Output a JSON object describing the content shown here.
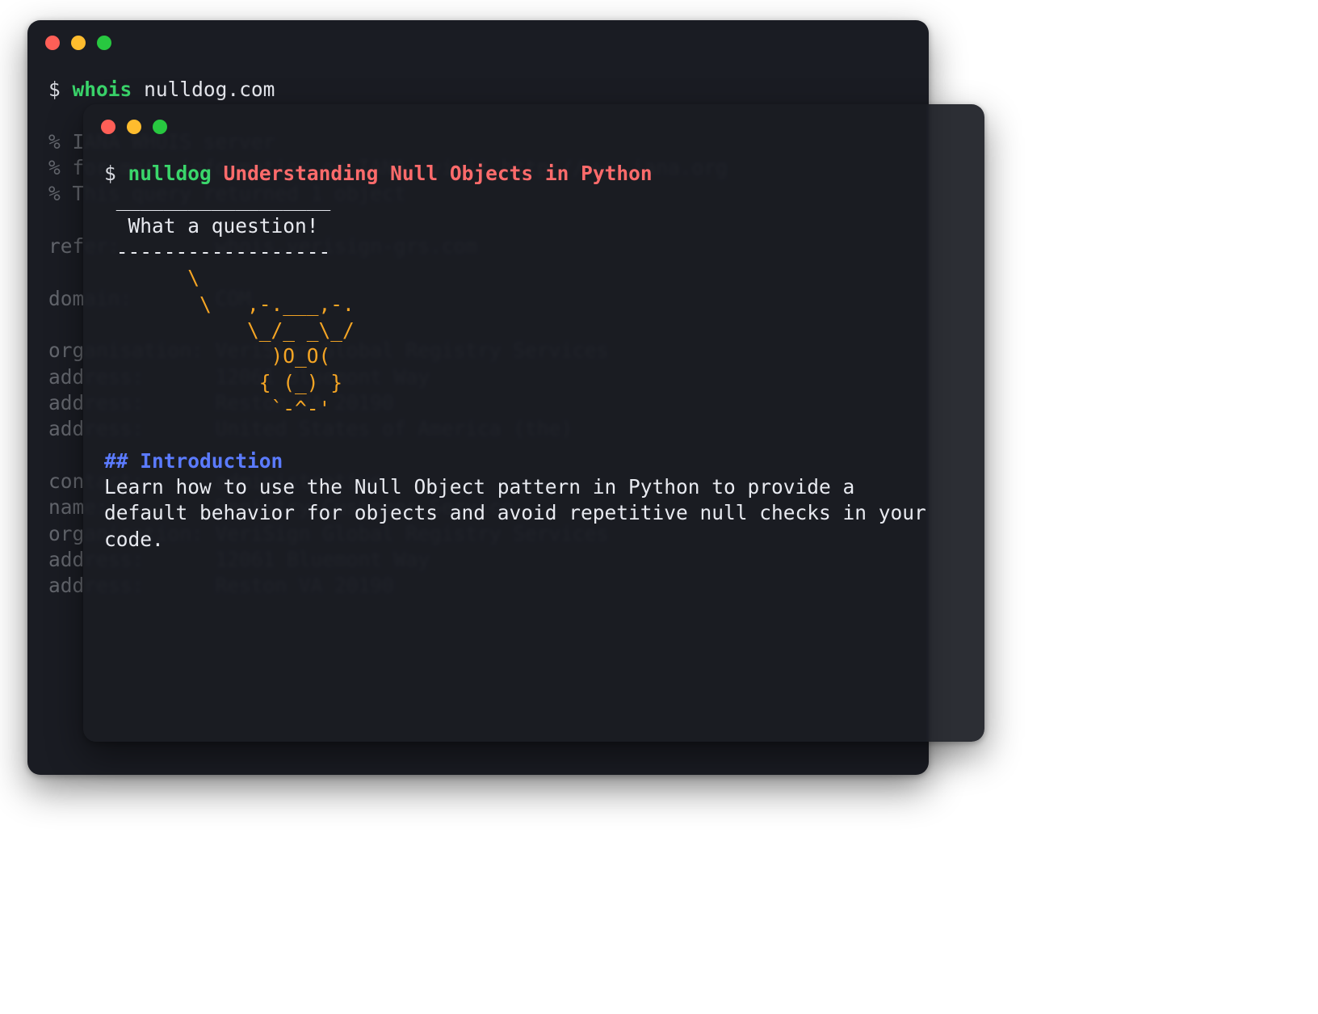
{
  "colors": {
    "traffic_red": "#ff5f57",
    "traffic_yellow": "#febc2e",
    "traffic_green": "#28c840",
    "prompt_green": "#3ad66b",
    "title_red": "#ff6b6b",
    "heading_blue": "#5b7bff",
    "ascii_orange": "#f5a524"
  },
  "back": {
    "prompt_sym": "$",
    "command": "whois",
    "arg": "nulldog.com",
    "lines": {
      "l0": "% IANA WHOIS server",
      "l1": "% for more information on IANA, visit http://www.iana.org",
      "l2": "% This query returned 1 object",
      "l3": "",
      "l4": "refer:        whois.verisign-grs.com",
      "l5": "",
      "l6": "domain:       COM",
      "l7": "",
      "l8": "organisation: VeriSign Global Registry Services",
      "l9": "address:      12061 Bluemont Way",
      "l10": "address:      Reston VA 20190",
      "l11": "address:      United States of America (the)",
      "l12": "",
      "l13": "contact:      administrative",
      "l14": "name:         Registry Customer Service",
      "l15": "organisation: VeriSign Global Registry Services",
      "l16": "address:      12061 Bluemont Way",
      "l17": "address:      Reston VA 20190"
    }
  },
  "front": {
    "prompt_sym": "$",
    "command": "nulldog",
    "title": "Understanding Null Objects in Python",
    "speech": {
      "top": " __________________",
      "text": "  What a question!",
      "bottom": " ------------------"
    },
    "dog": {
      "l0": "       \\",
      "l1": "        \\   ,-.___,-.",
      "l2": "            \\_/_ _\\_/",
      "l3": "              )O_O(",
      "l4": "             { (_) }",
      "l5": "              `-^-'"
    },
    "heading": "## Introduction",
    "paragraph": "Learn how to use the Null Object pattern in Python to provide a default behavior for objects and avoid repetitive null checks in your code."
  }
}
